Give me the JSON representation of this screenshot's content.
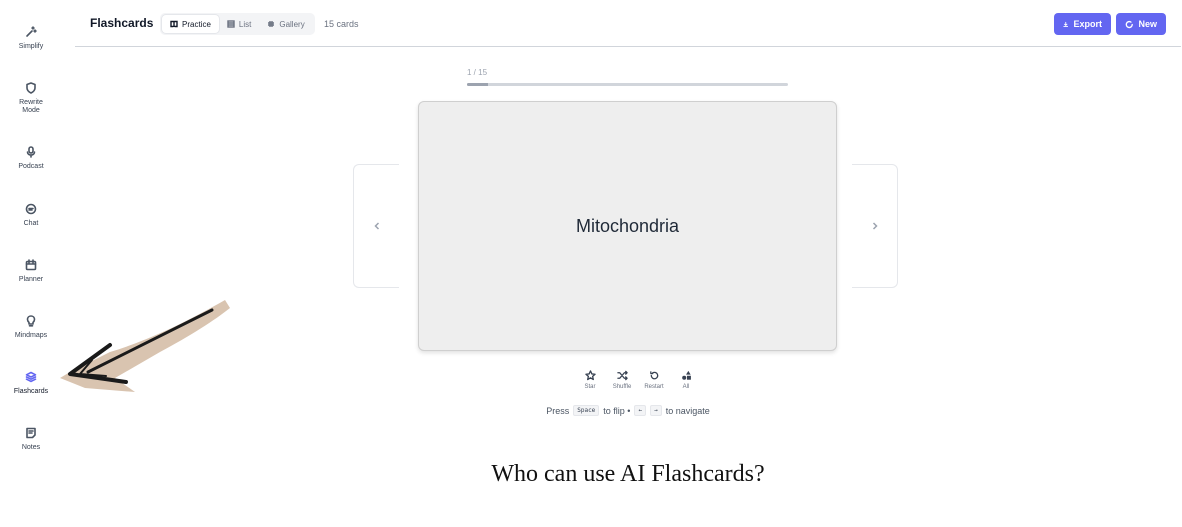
{
  "sidebar": {
    "items": [
      {
        "label": "Simplify",
        "icon": "magic-wand-icon",
        "active": false
      },
      {
        "label": "Rewrite Mode",
        "icon": "shield-icon",
        "active": false
      },
      {
        "label": "Podcast",
        "icon": "microphone-icon",
        "active": false
      },
      {
        "label": "Chat",
        "icon": "chat-bubble-icon",
        "active": false
      },
      {
        "label": "Planner",
        "icon": "calendar-icon",
        "active": false
      },
      {
        "label": "Mindmaps",
        "icon": "lightbulb-icon",
        "active": false
      },
      {
        "label": "Flashcards",
        "icon": "layers-icon",
        "active": true
      },
      {
        "label": "Notes",
        "icon": "note-icon",
        "active": false
      }
    ]
  },
  "header": {
    "title": "Flashcards",
    "tabs": [
      {
        "label": "Practice",
        "icon": "book-icon",
        "active": true
      },
      {
        "label": "List",
        "icon": "list-icon",
        "active": false
      },
      {
        "label": "Gallery",
        "icon": "grid-icon",
        "active": false
      }
    ],
    "count": "15 cards",
    "export_label": "Export",
    "new_label": "New"
  },
  "practice": {
    "position": "1 / 15",
    "progress_fraction": 0.0667,
    "card_term": "Mitochondria"
  },
  "actions": [
    {
      "label": "Star",
      "icon": "star-icon"
    },
    {
      "label": "Shuffle",
      "icon": "shuffle-icon"
    },
    {
      "label": "Restart",
      "icon": "restart-icon"
    },
    {
      "label": "All",
      "icon": "shapes-icon"
    }
  ],
  "hint": {
    "press": "Press",
    "space_key": "Space",
    "flip_text": "to flip •",
    "left_key": "←",
    "right_key": "→",
    "navigate_text": "to navigate"
  },
  "section": {
    "heading": "Who can use AI Flashcards?"
  },
  "colors": {
    "accent": "#6366f1",
    "card_bg": "#eeeeee",
    "annotation_arrow": "#1a1a1a",
    "annotation_brush": "#d9c4b0"
  }
}
